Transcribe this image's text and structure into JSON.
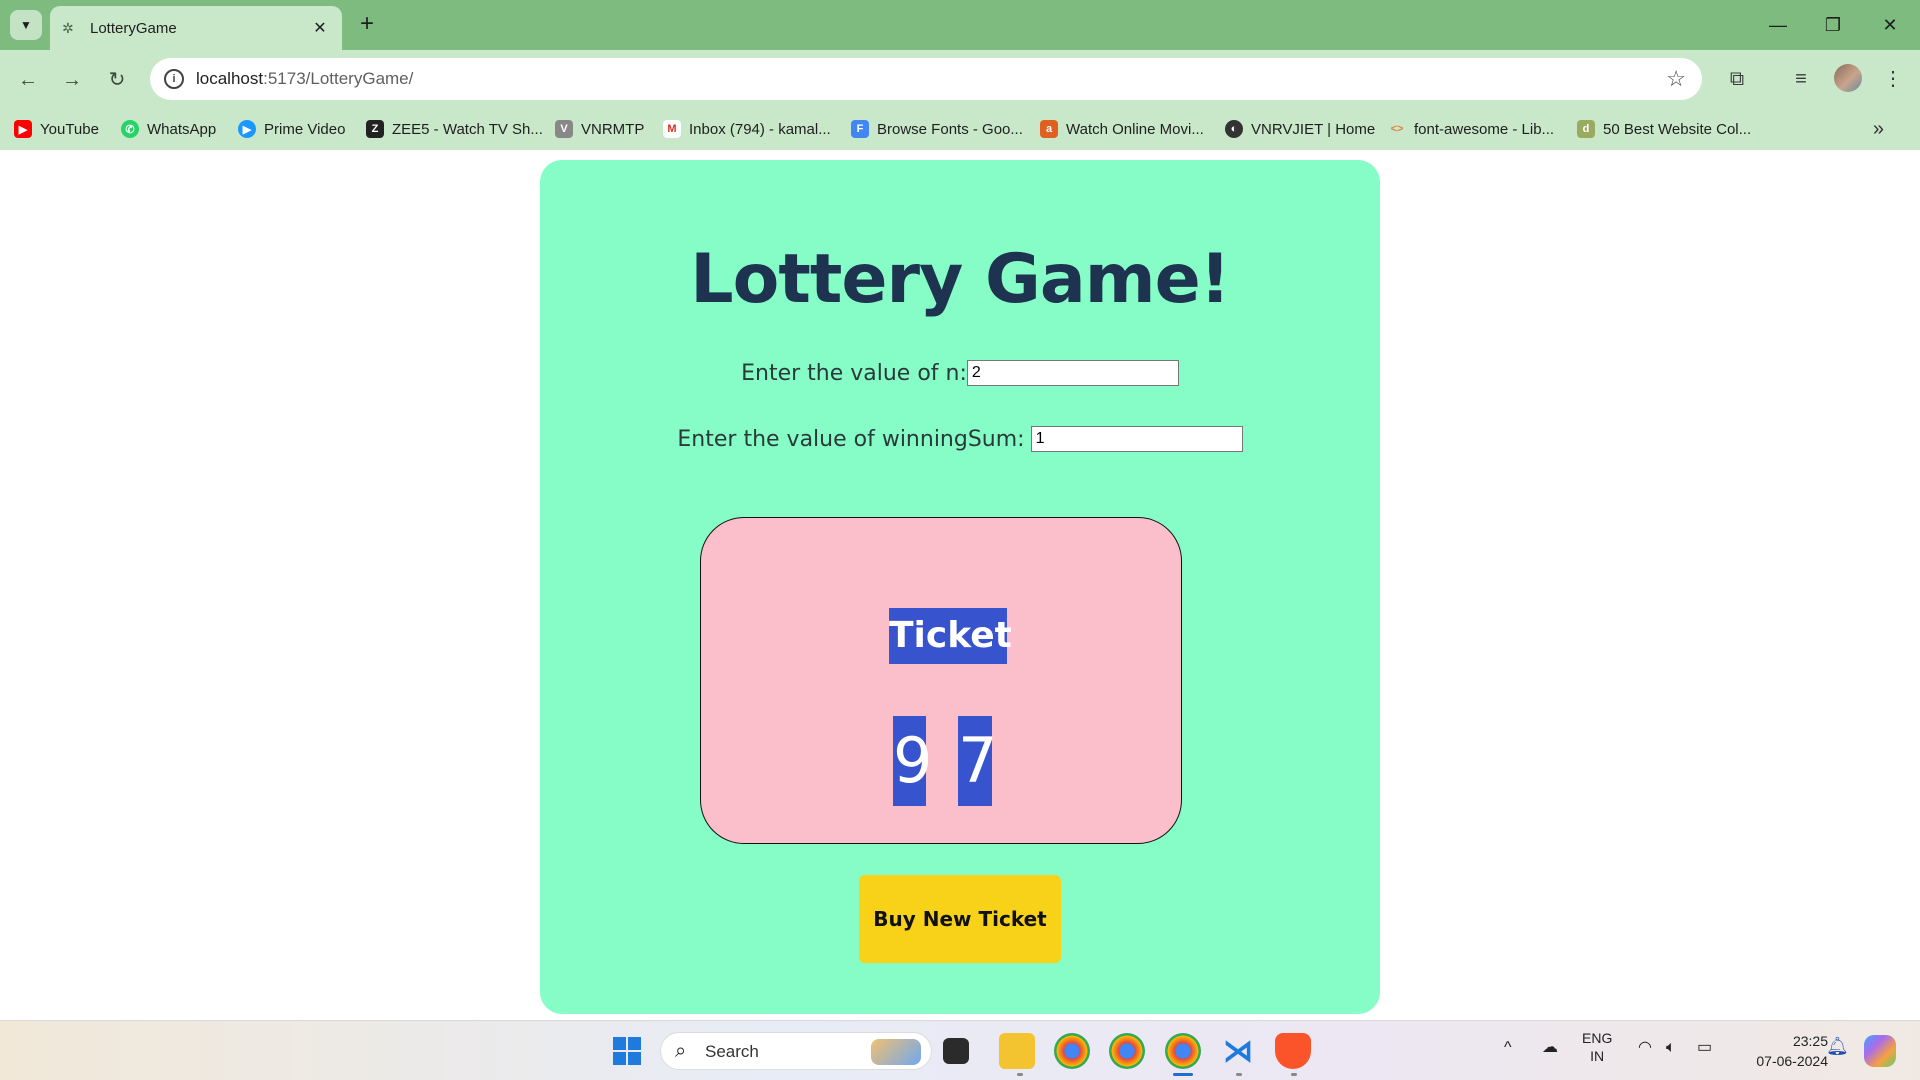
{
  "browser": {
    "tab_title": "LotteryGame",
    "tab_close": "✕",
    "new_tab": "+",
    "url_host": "localhost",
    "url_path": ":5173/LotteryGame/",
    "bookmarks": [
      {
        "label": "YouTube",
        "color": "#ff0000",
        "glyph": "▶"
      },
      {
        "label": "WhatsApp",
        "color": "#25d366",
        "glyph": "✆"
      },
      {
        "label": "Prime Video",
        "color": "#1a98ff",
        "glyph": "▶"
      },
      {
        "label": "ZEE5 - Watch TV Sh...",
        "color": "#222222",
        "glyph": "Z"
      },
      {
        "label": "VNRMTP",
        "color": "#888888",
        "glyph": "V"
      },
      {
        "label": "Inbox (794) - kamal...",
        "color": "#d93025",
        "glyph": "M"
      },
      {
        "label": "Browse Fonts - Goo...",
        "color": "#4285f4",
        "glyph": "F"
      },
      {
        "label": "Watch Online Movi...",
        "color": "#e06020",
        "glyph": "a"
      },
      {
        "label": "VNRVJIET | Home",
        "color": "#333333",
        "glyph": "◐"
      },
      {
        "label": "font-awesome - Lib...",
        "color": "#e08040",
        "glyph": "<>"
      },
      {
        "label": "50 Best Website Col...",
        "color": "#9aaa60",
        "glyph": "d"
      }
    ]
  },
  "page": {
    "heading": "Lottery Game!",
    "n_label": "Enter the value of n:",
    "n_value": "2",
    "sum_label": "Enter the value of winningSum:",
    "sum_value": "1",
    "ticket_label": "Ticket",
    "ticket_digits": [
      "9",
      "7"
    ],
    "buy_button": "Buy New Ticket"
  },
  "colors": {
    "card_bg": "#86fdc7",
    "ticket_bg": "#fbbecb",
    "highlight": "#3753cd",
    "button_bg": "#f7d219",
    "heading": "#1e3350"
  },
  "taskbar": {
    "search_placeholder": "Search",
    "lang_top": "ENG",
    "lang_bottom": "IN",
    "time": "23:25",
    "date": "07-06-2024"
  }
}
